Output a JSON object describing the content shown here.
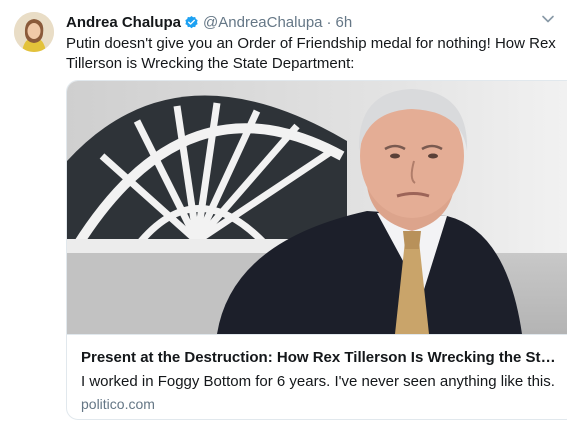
{
  "tweet": {
    "author_name": "Andrea Chalupa",
    "author_handle": "@AndreaChalupa",
    "separator": "·",
    "time": "6h",
    "text": "Putin doesn't give you an Order of Friendship medal for nothing! How Rex Tillerson is Wrecking the State Department:",
    "verified_icon": "verified-badge-icon",
    "menu_icon": "chevron-down-icon"
  },
  "card": {
    "title": "Present at the Destruction: How Rex Tillerson Is Wrecking the State ...",
    "description": "I worked in Foggy Bottom for 6 years. I've never seen anything like this.",
    "domain": "politico.com"
  },
  "colors": {
    "verified": "#1da1f2",
    "secondary_text": "#657786",
    "border": "#e1e8ed"
  }
}
